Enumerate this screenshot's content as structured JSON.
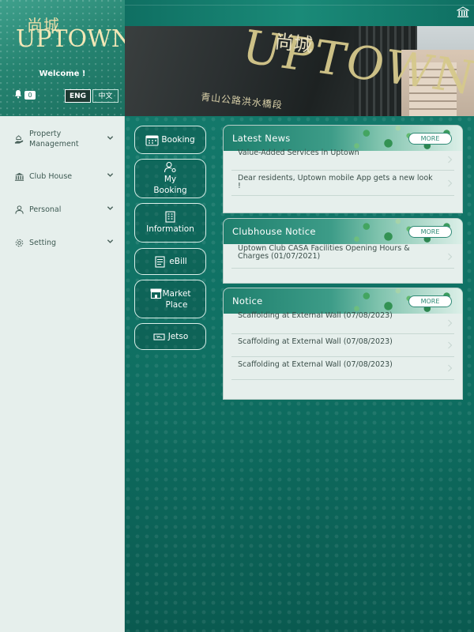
{
  "sidebar": {
    "logo_cn": "尚城",
    "logo_en": "UPTOWN",
    "welcome": "Welcome !",
    "notification_count": "0",
    "lang_eng": "ENG",
    "lang_zh": "中文",
    "menu": [
      {
        "label": "Property Management",
        "icon": "hand-house-icon"
      },
      {
        "label": "Club House",
        "icon": "clubhouse-icon"
      },
      {
        "label": "Personal",
        "icon": "person-icon"
      },
      {
        "label": "Setting",
        "icon": "gear-icon"
      }
    ]
  },
  "hero": {
    "sign_cn": "尚城",
    "sign_en": "UPTOWN",
    "address": "青山公路洪水橋段"
  },
  "quick_links": [
    {
      "label": "Booking",
      "icon": "calendar-icon"
    },
    {
      "label": "My Booking",
      "icon": "person-gear-icon"
    },
    {
      "label": "Information",
      "icon": "building-icon"
    },
    {
      "label": "eBill",
      "icon": "bill-icon"
    },
    {
      "label": "Market Place",
      "icon": "store-icon"
    },
    {
      "label": "Jetso",
      "icon": "ticket-icon"
    }
  ],
  "latest_news": {
    "title": "Latest News",
    "more": "MORE",
    "items": [
      "Value-Added Services in Uptown",
      "Dear residents, Uptown mobile App gets a new look !"
    ]
  },
  "clubhouse_notice": {
    "title": "Clubhouse Notice",
    "more": "MORE",
    "items": [
      "Uptown Club CASA Facilities Opening Hours & Charges (01/07/2021)"
    ]
  },
  "notice": {
    "title": "Notice",
    "more": "MORE",
    "items": [
      "Scaffolding at External Wall (07/08/2023)",
      "Scaffolding at External Wall (07/08/2023)",
      "Scaffolding at External Wall (07/08/2023)"
    ]
  },
  "colors": {
    "brand_green": "#0f7165",
    "sidebar_bg": "#e6efec",
    "gold": "#e9dca7"
  }
}
